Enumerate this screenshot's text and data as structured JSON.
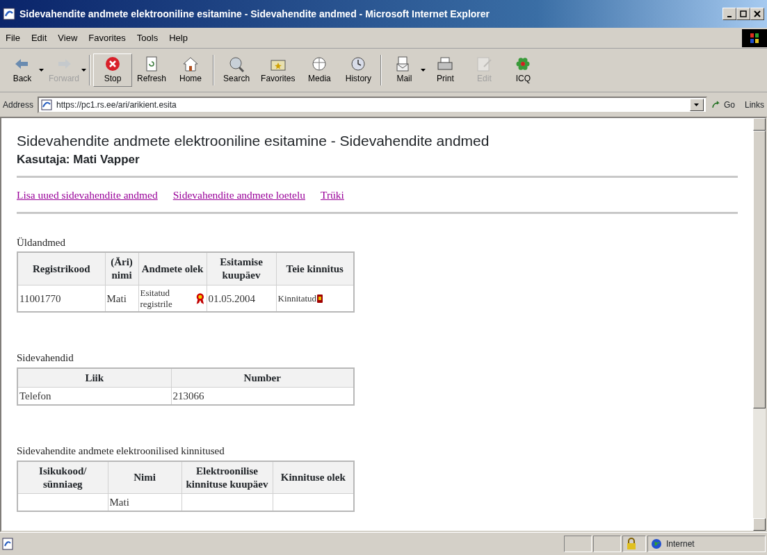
{
  "window": {
    "title": "Sidevahendite andmete elektrooniline esitamine - Sidevahendite andmed - Microsoft Internet Explorer"
  },
  "menu": {
    "items": [
      {
        "label": "File"
      },
      {
        "label": "Edit"
      },
      {
        "label": "View"
      },
      {
        "label": "Favorites"
      },
      {
        "label": "Tools"
      },
      {
        "label": "Help"
      }
    ]
  },
  "toolbar": {
    "buttons": [
      {
        "label": "Back",
        "kind": "back",
        "disabled": false,
        "hovered": false,
        "dropdown": true
      },
      {
        "label": "Forward",
        "kind": "forward",
        "disabled": true,
        "hovered": false,
        "dropdown": true
      },
      {
        "label": "Stop",
        "kind": "stop",
        "disabled": false,
        "hovered": true,
        "dropdown": false
      },
      {
        "label": "Refresh",
        "kind": "refresh",
        "disabled": false,
        "hovered": false,
        "dropdown": false
      },
      {
        "label": "Home",
        "kind": "home",
        "disabled": false,
        "hovered": false,
        "dropdown": false
      },
      {
        "label": "Search",
        "kind": "search",
        "disabled": false,
        "hovered": false,
        "dropdown": false
      },
      {
        "label": "Favorites",
        "kind": "favorites",
        "disabled": false,
        "hovered": false,
        "dropdown": false
      },
      {
        "label": "Media",
        "kind": "media",
        "disabled": false,
        "hovered": false,
        "dropdown": false
      },
      {
        "label": "History",
        "kind": "history",
        "disabled": false,
        "hovered": false,
        "dropdown": false
      },
      {
        "label": "Mail",
        "kind": "mail",
        "disabled": false,
        "hovered": false,
        "dropdown": true
      },
      {
        "label": "Print",
        "kind": "print",
        "disabled": false,
        "hovered": false,
        "dropdown": false
      },
      {
        "label": "Edit",
        "kind": "edit",
        "disabled": true,
        "hovered": false,
        "dropdown": false
      },
      {
        "label": "ICQ",
        "kind": "icq",
        "disabled": false,
        "hovered": false,
        "dropdown": false
      }
    ]
  },
  "address_bar": {
    "label": "Address",
    "value": "https://pc1.rs.ee/ari/arikient.esita",
    "go": "Go",
    "links": "Links"
  },
  "page": {
    "heading": "Sidevahendite andmete elektrooniline esitamine - Sidevahendite andmed",
    "user": "Kasutaja: Mati Vapper",
    "links": [
      {
        "label": "Lisa uued sidevahendite andmed",
        "visited": true
      },
      {
        "label": "Sidevahendite andmete loetelu",
        "visited": true
      },
      {
        "label": "Trüki",
        "visited": true
      }
    ],
    "sections": [
      {
        "title": "Üldandmed",
        "kind": "general",
        "columns": [
          "Registrikood",
          "(Äri) nimi",
          "Andmete olek",
          "Esitamise kuupäev",
          "Teie kinnitus"
        ],
        "rows": [
          {
            "cells": [
              {
                "text": "11001770",
                "kind": "plain"
              },
              {
                "text": "Mati",
                "kind": "plain"
              },
              {
                "text": "Esitatud registrile",
                "kind": "ribbon"
              },
              {
                "text": "01.05.2004",
                "kind": "plain"
              },
              {
                "text": "Kinnitatud",
                "kind": "seal"
              }
            ]
          }
        ]
      },
      {
        "title": "Sidevahendid",
        "kind": "contacts",
        "columns": [
          "Liik",
          "Number"
        ],
        "rows": [
          {
            "cells": [
              {
                "text": "Telefon",
                "kind": "plain"
              },
              {
                "text": "213066",
                "kind": "plain"
              }
            ]
          }
        ]
      },
      {
        "title": "Sidevahendite andmete elektroonilised kinnitused",
        "kind": "confirmations",
        "columns": [
          "Isikukood/ sünniaeg",
          "Nimi",
          "Elektroonilise kinnituse kuupäev",
          "Kinnituse olek"
        ],
        "rows": [
          {
            "cells": [
              {
                "text": null
              },
              {
                "text": "Mati",
                "kind": "plain"
              },
              {
                "text": null
              },
              {
                "text": null
              }
            ]
          }
        ]
      }
    ]
  },
  "status_bar": {
    "zone": "Internet",
    "secure": true
  }
}
